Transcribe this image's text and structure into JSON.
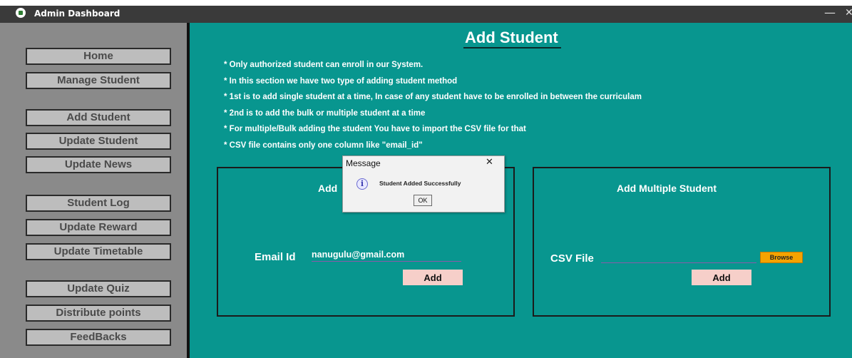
{
  "window": {
    "title": "Admin Dashboard",
    "icon": "app-icon",
    "minimize_glyph": "—",
    "close_glyph": "✕"
  },
  "sidebar": {
    "items": [
      {
        "label": "Home"
      },
      {
        "label": "Manage Student"
      },
      {
        "label": "Add Student"
      },
      {
        "label": "Update Student"
      },
      {
        "label": "Update News"
      },
      {
        "label": "Student Log"
      },
      {
        "label": "Update Reward"
      },
      {
        "label": "Update Timetable"
      },
      {
        "label": "Update Quiz"
      },
      {
        "label": "Distribute points"
      },
      {
        "label": "FeedBacks"
      }
    ]
  },
  "main": {
    "title": "Add Student",
    "notes": [
      "* Only authorized student can enroll in our System.",
      "* In this section we have two type of adding student method",
      "* 1st is to add single student at a time, In case of any student have to be enrolled in between the curriculam",
      "* 2nd is to add the bulk or multiple student at a time",
      "* For multiple/Bulk adding the student You have to import the CSV file for that",
      "* CSV file contains only one column like \"email_id\""
    ],
    "single_panel": {
      "title_visible": "Add",
      "email_label": "Email Id",
      "email_value": "nanugulu@gmail.com",
      "add_label": "Add"
    },
    "multi_panel": {
      "title": "Add Multiple Student",
      "csv_label": "CSV File",
      "csv_value": "",
      "browse_label": "Browse",
      "add_label": "Add"
    }
  },
  "dialog": {
    "title": "Message",
    "close_glyph": "✕",
    "icon": "info-icon",
    "icon_glyph": "i",
    "message": "Student Added Successfully",
    "ok_label": "OK"
  },
  "colors": {
    "main_bg": "#08968f",
    "sidebar_bg": "#8a8a8a",
    "sidebar_button": "#bdbdbd",
    "add_button": "#f6cfc9",
    "browse_button": "#f5a300",
    "titlebar": "#3a3a3a"
  }
}
